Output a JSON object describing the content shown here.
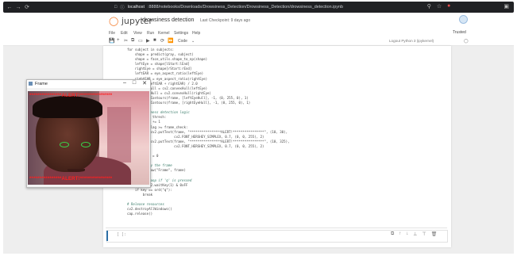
{
  "browser": {
    "url_host": "localhost",
    "url_path": ":8888/notebooks/Downloads/Drowsiness_Detection/Drowsiness_Detection/drowsiness_detection.ipynb"
  },
  "notebook": {
    "logo_text": "jupyter",
    "title": "drowsiness detection",
    "checkpoint": "Last Checkpoint: 9 days ago",
    "trusted": "Trusted",
    "kernel_info": "Logout   Python 3 (ipykernel)"
  },
  "menu": [
    "File",
    "Edit",
    "View",
    "Run",
    "Kernel",
    "Settings",
    "Help"
  ],
  "toolbar": {
    "cell_type": "Code"
  },
  "code_lines": [
    {
      "text": "for subject in subjects:",
      "cls": ""
    },
    {
      "text": "    shape = predict(gray, subject)",
      "cls": ""
    },
    {
      "text": "    shape = face_utils.shape_to_np(shape)",
      "cls": ""
    },
    {
      "text": "    leftEye = shape[lStart:lEnd]",
      "cls": ""
    },
    {
      "text": "    rightEye = shape[rStart:rEnd]",
      "cls": ""
    },
    {
      "text": "    leftEAR = eye_aspect_ratio(leftEye)",
      "cls": ""
    },
    {
      "text": "    rightEAR = eye_aspect_ratio(rightEye)",
      "cls": ""
    },
    {
      "text": "    ear = (leftEAR + rightEAR) / 2.0",
      "cls": ""
    },
    {
      "text": "    leftEyeHull = cv2.convexHull(leftEye)",
      "cls": ""
    },
    {
      "text": "    rightEyeHull = cv2.convexHull(rightEye)",
      "cls": ""
    },
    {
      "text": "    cv2.drawContours(frame, [leftEyeHull], -1, (0, 255, 0), 1)",
      "cls": ""
    },
    {
      "text": "    cv2.drawContours(frame, [rightEyeHull], -1, (0, 255, 0), 1)",
      "cls": ""
    },
    {
      "text": "",
      "cls": ""
    },
    {
      "text": "    # Drowsiness detection logic",
      "cls": "cm"
    },
    {
      "text": "    if ear < thresh:",
      "cls": ""
    },
    {
      "text": "        flag += 1",
      "cls": ""
    },
    {
      "text": "        if flag >= frame_check:",
      "cls": ""
    },
    {
      "text": "            cv2.putText(frame, \"****************ALERT!****************\", (10, 30),",
      "cls": ""
    },
    {
      "text": "                        cv2.FONT_HERSHEY_SIMPLEX, 0.7, (0, 0, 255), 2)",
      "cls": ""
    },
    {
      "text": "            cv2.putText(frame, \"****************ALERT!****************\", (10, 325),",
      "cls": ""
    },
    {
      "text": "                        cv2.FONT_HERSHEY_SIMPLEX, 0.7, (0, 0, 255), 2)",
      "cls": ""
    },
    {
      "text": "    else:",
      "cls": ""
    },
    {
      "text": "        flag = 0",
      "cls": ""
    },
    {
      "text": "",
      "cls": ""
    },
    {
      "text": "    # Display the frame",
      "cls": "cm"
    },
    {
      "text": "    cv2.imshow(\"Frame\", frame)",
      "cls": ""
    },
    {
      "text": "",
      "cls": ""
    },
    {
      "text": "    # Exit loop if 'q' is pressed",
      "cls": "cm"
    },
    {
      "text": "    key = cv2.waitKey(1) & 0xFF",
      "cls": ""
    },
    {
      "text": "    if key == ord(\"q\"):",
      "cls": ""
    },
    {
      "text": "        break",
      "cls": ""
    },
    {
      "text": "",
      "cls": ""
    },
    {
      "text": "# Release resources",
      "cls": "cm"
    },
    {
      "text": "cv2.destroyAllWindows()",
      "cls": ""
    },
    {
      "text": "cap.release()",
      "cls": ""
    }
  ],
  "empty_cell": {
    "prompt": "[ ]:"
  },
  "frame_window": {
    "title": "Frame",
    "alert_top": "****************ALERT!****************",
    "alert_bottom": "****************ALERT!****************",
    "colors": {
      "alert": "#ff2020",
      "eye_contour": "#39d24a"
    }
  }
}
